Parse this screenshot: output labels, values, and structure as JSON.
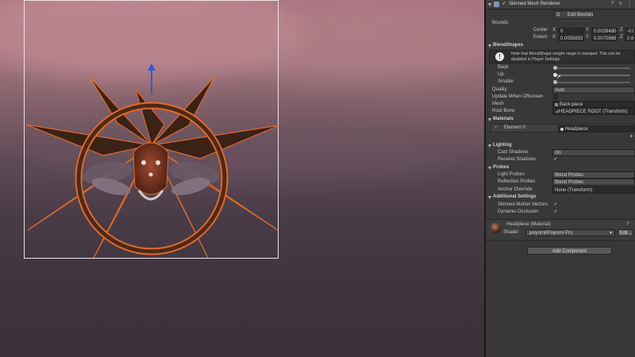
{
  "scene": {},
  "inspector": {
    "component_title": "Skinned Mesh Renderer",
    "edit_bounds_label": "Edit Bounds",
    "bounds_label": "Bounds",
    "center": {
      "label": "Center",
      "x": "0",
      "y": "0.0039480",
      "z": "-0.0"
    },
    "extent": {
      "label": "Extent",
      "x": "0.0055853",
      "y": "0.0070969",
      "z": "0.00"
    },
    "blendshapes_label": "BlendShapes",
    "note": "Note that BlendShape weight range is clamped. This can be disabled in Player Settings.",
    "blendshapes": [
      {
        "name": "Back",
        "value": 0
      },
      {
        "name": "Up",
        "value": 0
      },
      {
        "name": "Smaller",
        "value": 0
      }
    ],
    "quality": {
      "label": "Quality",
      "value": "Auto"
    },
    "update_offscreen": {
      "label": "Update When Offscreen"
    },
    "mesh": {
      "label": "Mesh",
      "value": "Back piece"
    },
    "root_bone": {
      "label": "Root Bone",
      "value": "⊿HEADPIECE ROOT (Transform)"
    },
    "materials_label": "Materials",
    "element0": {
      "label": "Element 0",
      "value": "Headpiece"
    },
    "lighting_label": "Lighting",
    "cast_shadows": {
      "label": "Cast Shadows",
      "value": "On"
    },
    "receive_shadows": {
      "label": "Receive Shadows"
    },
    "probes_label": "Probes",
    "light_probes": {
      "label": "Light Probes",
      "value": "Blend Probes"
    },
    "reflection_probes": {
      "label": "Reflection Probes",
      "value": "Blend Probes"
    },
    "anchor_override": {
      "label": "Anchor Override",
      "value": "None (Transform)"
    },
    "additional_label": "Additional Settings",
    "skinned_motion": {
      "label": "Skinned Motion Vectors"
    },
    "dynamic_occlusion": {
      "label": "Dynamic Occlusion"
    },
    "material_name": "Headpiece (Material)",
    "shader_label": "Shader",
    "shader_value": ".poiyomi/Poiyomi Pro",
    "edit_label": "Edit...",
    "add_component_label": "Add Component"
  },
  "colors": {
    "gizmo_blue": "#2d5bd8",
    "selection_orange": "#e0692a",
    "inspector_bg": "#383838"
  }
}
